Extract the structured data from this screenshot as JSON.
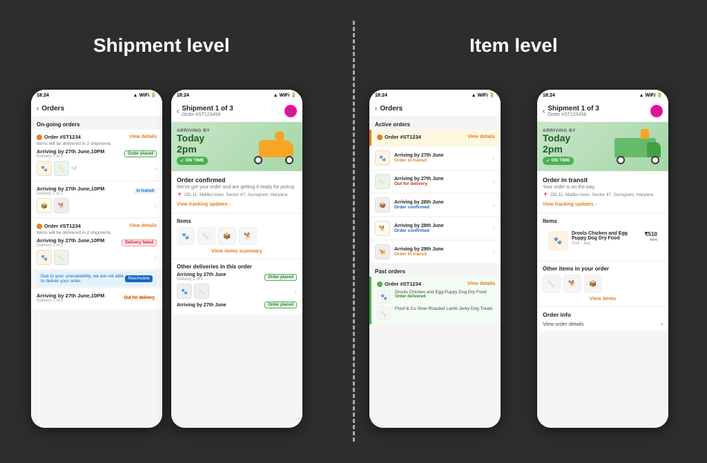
{
  "background": "#2d2d2d",
  "titles": {
    "shipment_level": "Shipment level",
    "item_level": "Item level"
  },
  "phone1": {
    "status_time": "18:24",
    "nav_title": "Orders",
    "section_active": "On-going orders",
    "orders": [
      {
        "id": "Order #ST1234",
        "sub": "Items will be delivered in 2 shipments",
        "view": "View details",
        "delivery1": "Arriving by 27th June,10PM",
        "delivery1_count": "Delivery 1 of 2",
        "badge1": "Order placed",
        "delivery2": "Arriving by 27th June,10PM",
        "delivery2_count": "Delivery 2 of 2",
        "badge2": "In transit"
      },
      {
        "id": "Order #ST1234",
        "sub": "Items will be delivered in 2 shipments",
        "view": "View details",
        "delivery1": "Arriving by 27th June,10PM",
        "delivery1_count": "Delivery 1 of 2",
        "badge1": "Delivery failed",
        "alert": "Due to your unavailability, we are not able to deliver your order.",
        "reschedule": "Reschedule"
      }
    ],
    "last_delivery": "Arriving by 27th June,10PM",
    "last_delivery_count": "Delivery 2 of 2",
    "last_badge": "Out for delivery"
  },
  "phone2": {
    "status_time": "18:24",
    "nav_title": "Shipment 1 of 3",
    "nav_subtitle": "Order #ST123456",
    "arriving_label": "ARRIVING BY",
    "arriving_time": "Today\n2pm",
    "on_time": "ON TIME",
    "section_title": "Order confirmed",
    "section_sub": "We've got your order and are getting it ready for pickup",
    "location": "OD 11, Malibu town, Sector 47, Gurugram, Haryana",
    "track_link": "View tracking updates",
    "items_title": "Items",
    "view_summary": "View items summary",
    "other_deliveries_title": "Other deliveries in this order",
    "other_delivery1_date": "Arriving by 27th June",
    "other_delivery1_badge": "Order placed",
    "other_delivery1_count": "Delivery 1 of 2",
    "other_delivery2": "Arriving by 27th June",
    "other_delivery2_badge": "Order placed"
  },
  "phone3": {
    "status_time": "18:24",
    "nav_title": "Orders",
    "section_active": "Active orders",
    "section_past": "Past orders",
    "active_orders": [
      {
        "id": "Order #ST1234",
        "view": "View details",
        "date": "Arriving by 27th June",
        "status": "Order in transit"
      },
      {
        "date": "Arriving by 27th June",
        "status": "Out for delivery"
      },
      {
        "date": "Arriving by 28th June",
        "status": "Order confirmed"
      },
      {
        "date": "Arriving by 28th June",
        "status": "Order confirmed"
      },
      {
        "date": "Arriving by 29th June",
        "status": "Order in transit"
      }
    ],
    "past_order": {
      "id": "Order #ST1234",
      "view": "View details",
      "items": [
        {
          "name": "Drools Chicken and Egg Puppy Dog Dry Food",
          "status": "Order delivered"
        },
        {
          "name": "Floof & Co Slow Roasted Lamb Jerky Dog Treats",
          "status": ""
        }
      ]
    }
  },
  "phone4": {
    "status_time": "18:24",
    "nav_title": "Shipment 1 of 3",
    "nav_subtitle": "Order #ST123456",
    "arriving_label": "ARRIVING BY",
    "arriving_time": "Today\n2pm",
    "on_time": "ON TIME",
    "transit_title": "Order in transit",
    "transit_sub": "Your order is on the way",
    "location": "OD 11, Malibu town, Sector 47, Gurugram, Haryana",
    "track_link": "View tracking updates",
    "items_title": "Items",
    "item_name": "Drools Chicken and Egg Puppy Dog Dry Food",
    "item_size": "Size : 1kg",
    "item_price": "₹510",
    "item_orig_price": "600",
    "other_items_title": "Other items in your order",
    "view_items": "View items",
    "order_info_title": "Order info",
    "order_info_link": "View order details"
  },
  "icons": {
    "back_arrow": "‹",
    "chevron_right": "›",
    "location_pin": "📍",
    "check": "✓",
    "info": "ℹ",
    "dog": "🐕",
    "package": "📦"
  }
}
